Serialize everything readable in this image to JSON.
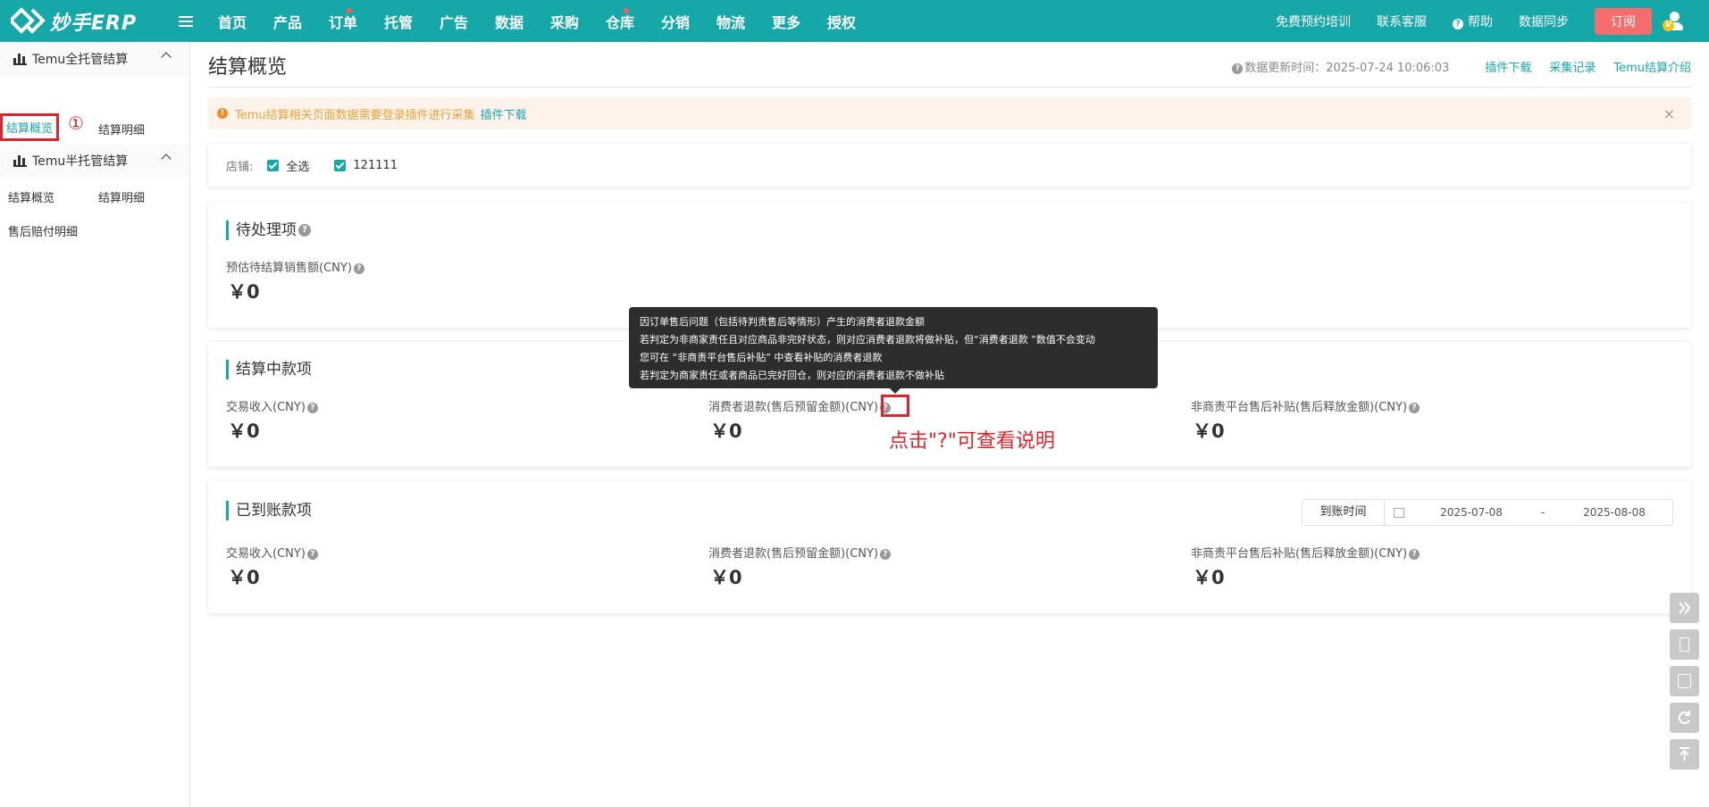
{
  "brand": {
    "logo_text": "妙手ERP",
    "accent": "#16a8a8",
    "danger": "#e0242e"
  },
  "nav": [
    "首页",
    "产品",
    "订单",
    "托管",
    "广告",
    "数据",
    "采购",
    "仓库",
    "分销",
    "物流",
    "更多",
    "授权"
  ],
  "top_right": {
    "training": "免费预约培训",
    "service": "联系客服",
    "help": "帮助",
    "sync": "数据同步",
    "order": "订阅",
    "vip": "V"
  },
  "sidebar": {
    "group1": "Temu全托管结算",
    "group1_items": [
      "结算概览",
      "结算明细",
      "售后赔付明细"
    ],
    "group2": "Temu半托管结算",
    "group2_items": [
      "结算概览",
      "结算明细"
    ],
    "marker": "①"
  },
  "page": {
    "title": "结算概览",
    "update_label": "数据更新时间：2025-07-24 10:06:03",
    "links": [
      "插件下载",
      "采集记录",
      "Temu结算介绍"
    ]
  },
  "alert": {
    "text": "Temu结算相关页面数据需要登录插件进行采集",
    "link": "插件下载",
    "close": "×"
  },
  "shop": {
    "label": "店铺:",
    "all": "全选",
    "shop1": "121111"
  },
  "pending": {
    "title": "待处理项",
    "label": "预估待结算销售额(CNY)",
    "value": "￥0"
  },
  "settling": {
    "title": "结算中款项",
    "items": [
      {
        "label": "交易收入(CNY)",
        "value": "￥0"
      },
      {
        "label": "消费者退款(售后预留金额)(CNY)",
        "value": "￥0"
      },
      {
        "label": "非商责平台售后补贴(售后释放金额)(CNY)",
        "value": "￥0"
      }
    ]
  },
  "received": {
    "title": "已到账款项",
    "date_btn": "到账时间",
    "date_from": "2025-07-08",
    "date_sep": "-",
    "date_to": "2025-08-08",
    "items": [
      {
        "label": "交易收入(CNY)",
        "value": "￥0"
      },
      {
        "label": "消费者退款(售后预留金额)(CNY)",
        "value": "￥0"
      },
      {
        "label": "非商责平台售后补贴(售后释放金额)(CNY)",
        "value": "￥0"
      }
    ]
  },
  "tooltip": {
    "lines": [
      "因订单售后问题（包括待判责售后等情形）产生的消费者退款金额",
      "若判定为非商家责任且对应商品非完好状态，则对应消费者退款将做补贴，但“消费者退款 ”数值不会变动",
      "您可在 “非商责平台售后补贴” 中查看补贴的消费者退款",
      "若判定为商家责任或者商品已完好回仓，则对应的消费者退款不做补贴"
    ]
  },
  "annotation": "点击\"?\"可查看说明",
  "help_icon_glyph": "?"
}
